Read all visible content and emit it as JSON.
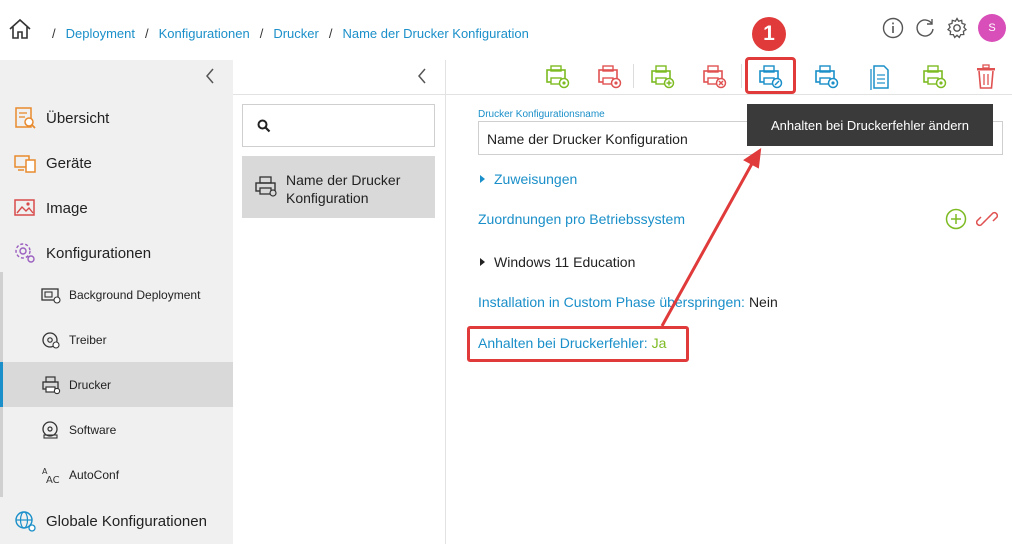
{
  "breadcrumb": {
    "items": [
      "Deployment",
      "Konfigurationen",
      "Drucker",
      "Name der Drucker Konfiguration"
    ],
    "separator": "/"
  },
  "user": {
    "avatar_initial": "S"
  },
  "sidebar": {
    "items": [
      {
        "label": "Übersicht",
        "icon": "overview-icon"
      },
      {
        "label": "Geräte",
        "icon": "devices-icon"
      },
      {
        "label": "Image",
        "icon": "image-icon"
      },
      {
        "label": "Konfigurationen",
        "icon": "configurations-icon"
      }
    ],
    "sub_items": [
      {
        "label": "Background Deployment",
        "icon": "background-deployment-icon"
      },
      {
        "label": "Treiber",
        "icon": "driver-icon"
      },
      {
        "label": "Drucker",
        "icon": "printer-icon",
        "active": true
      },
      {
        "label": "Software",
        "icon": "software-icon"
      },
      {
        "label": "AutoConf",
        "icon": "autoconf-icon"
      }
    ],
    "bottom_item": {
      "label": "Globale Konfigurationen",
      "icon": "global-config-icon"
    }
  },
  "list": {
    "search_placeholder": "",
    "selected_item": "Name der Drucker Konfiguration"
  },
  "toolbar": {
    "buttons": [
      "add-printer-config",
      "delete-printer-config",
      "add-printer",
      "remove-printer",
      "edit-stop-on-error",
      "printer-settings",
      "copy-config",
      "printer-export",
      "trash"
    ],
    "tooltip": "Anhalten bei Druckerfehler ändern",
    "step_badge": "1"
  },
  "detail": {
    "name_label": "Drucker Konfigurationsname",
    "name_value": "Name der Drucker Konfiguration",
    "assignments_label": "Zuweisungen",
    "os_mapping_label": "Zuordnungen pro Betriebssystem",
    "os_entry": "Windows 11 Education",
    "skip_custom_phase_key": "Installation in Custom Phase überspringen:",
    "skip_custom_phase_value": "Nein",
    "stop_on_error_key": "Anhalten bei Druckerfehler:",
    "stop_on_error_value": "Ja"
  },
  "colors": {
    "accent": "#1a8fc9",
    "highlight": "#e03a3a",
    "green": "#7dbb22",
    "avatar": "#d94fb9"
  }
}
